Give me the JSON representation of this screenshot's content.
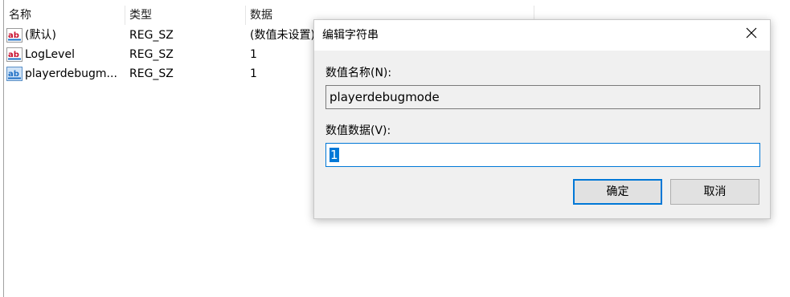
{
  "list": {
    "columns": [
      "名称",
      "类型",
      "数据"
    ],
    "rows": [
      {
        "name": "(默认)",
        "type": "REG_SZ",
        "data": "(数值未设置)"
      },
      {
        "name": "LogLevel",
        "type": "REG_SZ",
        "data": "1"
      },
      {
        "name": "playerdebugm...",
        "type": "REG_SZ",
        "data": "1"
      }
    ],
    "row_icon": "string-value-icon"
  },
  "dialog": {
    "title": "编辑字符串",
    "close_icon": "close-icon",
    "value_name_label": "数值名称(N):",
    "value_name": "playerdebugmode",
    "value_data_label": "数值数据(V):",
    "value_data": "1",
    "ok_label": "确定",
    "cancel_label": "取消"
  },
  "colors": {
    "accent": "#0078d7",
    "dialog_bg": "#f0f0f0",
    "button_bg": "#e1e1e1",
    "icon_red": "#c8102e",
    "icon_blue": "#1e6fc5"
  }
}
